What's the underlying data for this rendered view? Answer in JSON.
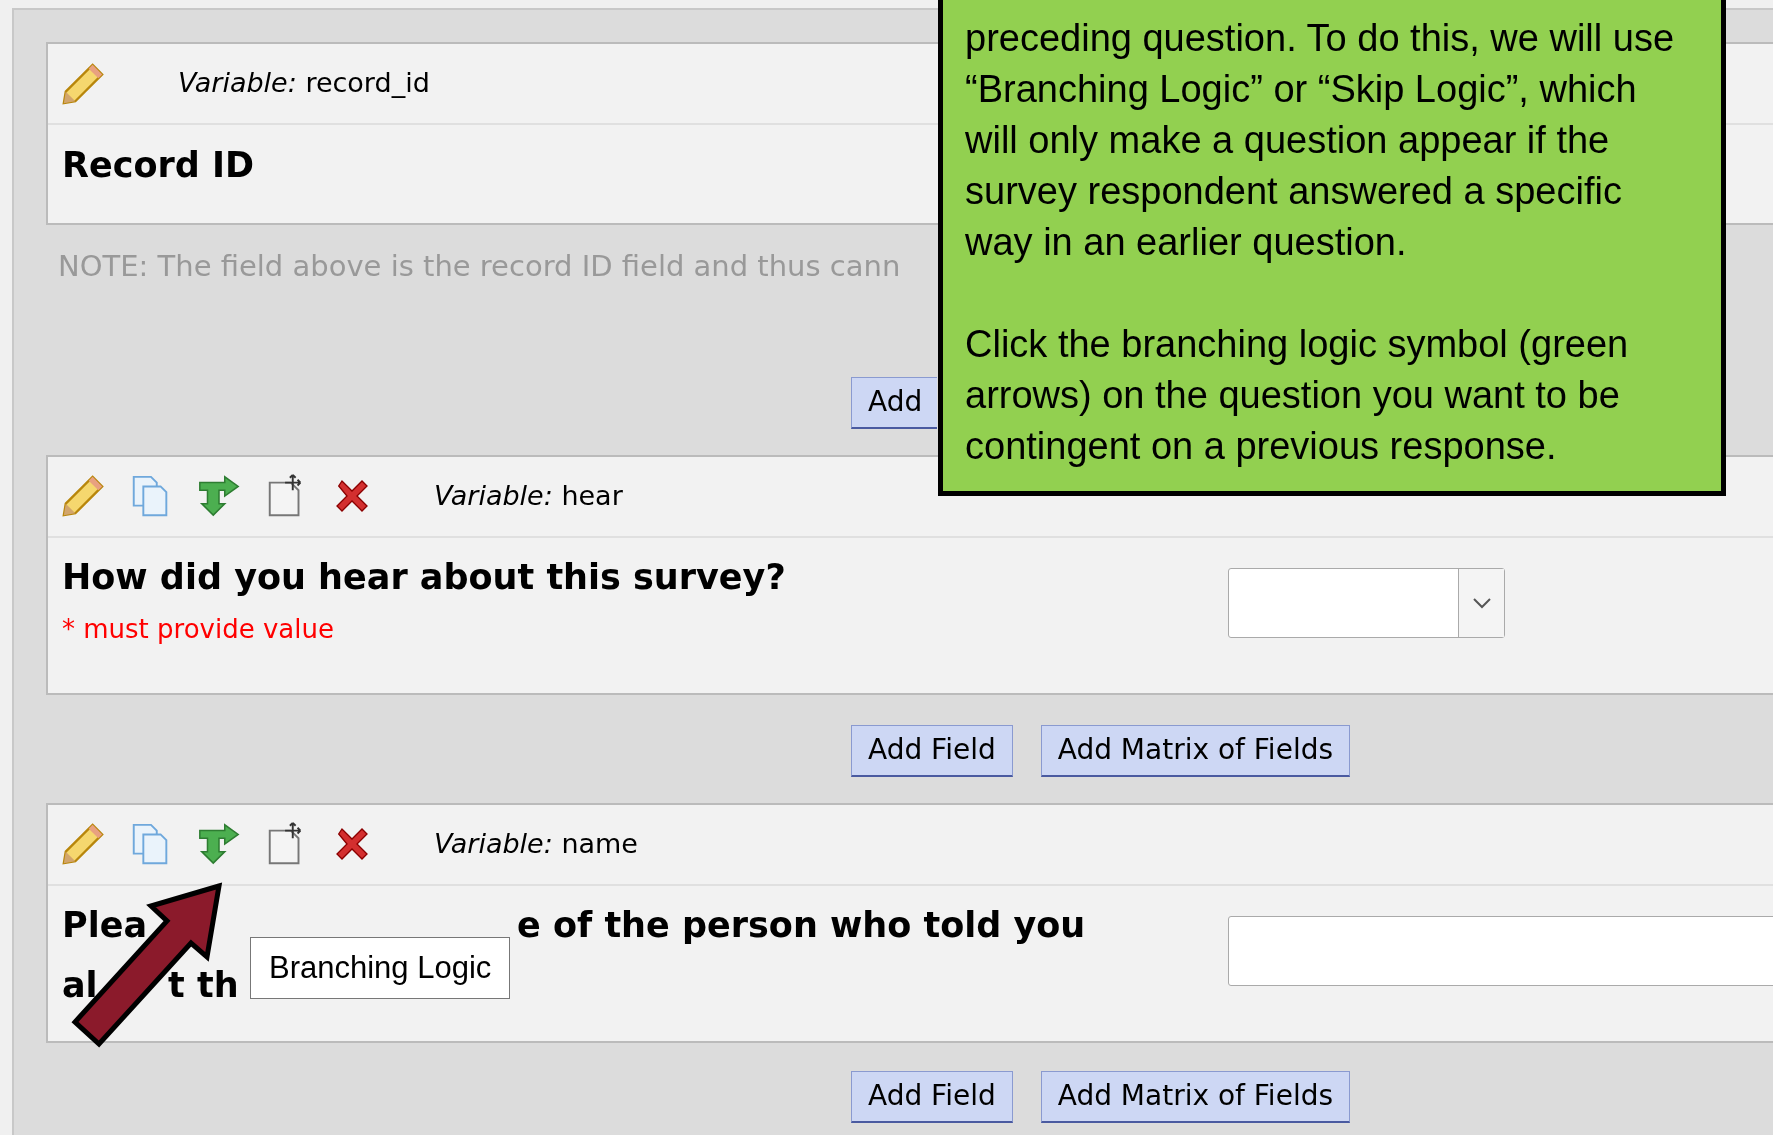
{
  "fields": [
    {
      "variable_label": "Variable:",
      "variable": "record_id",
      "tools": [
        {
          "kind": "edit"
        }
      ],
      "question_lines": [
        [
          "Record ID"
        ]
      ]
    },
    {
      "variable_label": "Variable:",
      "variable": "hear",
      "tools": [
        {
          "kind": "edit"
        },
        {
          "kind": "copy"
        },
        {
          "kind": "branch"
        },
        {
          "kind": "move"
        },
        {
          "kind": "delete"
        }
      ],
      "question_lines": [
        [
          "How did you hear about this survey?"
        ]
      ],
      "required_note": "* must provide value",
      "control": {
        "kind": "dropdown"
      }
    },
    {
      "variable_label": "Variable:",
      "variable": "name",
      "tools": [
        {
          "kind": "edit"
        },
        {
          "kind": "copy"
        },
        {
          "kind": "branch"
        },
        {
          "kind": "move"
        },
        {
          "kind": "delete"
        }
      ],
      "question_lines": [
        [
          "Plea",
          "e of the person who told you"
        ],
        [
          "al",
          "t th"
        ]
      ],
      "control": {
        "kind": "text"
      }
    }
  ],
  "note": "NOTE: The field above is the record ID field and thus cann",
  "button_rows": [
    [
      "Add"
    ],
    [
      "Add Field",
      "Add Matrix of Fields"
    ],
    [
      "Add Field",
      "Add Matrix of Fields"
    ]
  ],
  "tooltip": "Branching Logic",
  "callout": {
    "paragraphs": [
      "preceding question. To do this, we will use “Branching Logic” or “Skip Logic”, which will only make a question appear if the survey respondent answered a specific way in an earlier question.",
      "Click the branching logic symbol (green arrows) on the question you want to be contingent on a previous response."
    ]
  }
}
